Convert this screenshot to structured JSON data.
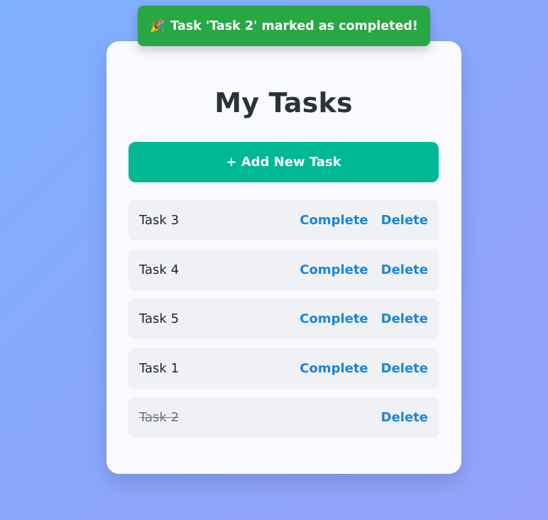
{
  "toast": {
    "icon": "🎉",
    "message": "Task 'Task 2' marked as completed!"
  },
  "page": {
    "title": "My Tasks",
    "add_button_label": "+ Add New Task"
  },
  "tasks": [
    {
      "name": "Task 3",
      "completed": false,
      "complete_label": "Complete",
      "delete_label": "Delete"
    },
    {
      "name": "Task 4",
      "completed": false,
      "complete_label": "Complete",
      "delete_label": "Delete"
    },
    {
      "name": "Task 5",
      "completed": false,
      "complete_label": "Complete",
      "delete_label": "Delete"
    },
    {
      "name": "Task 1",
      "completed": false,
      "complete_label": "Complete",
      "delete_label": "Delete"
    },
    {
      "name": "Task 2",
      "completed": true,
      "delete_label": "Delete"
    }
  ],
  "colors": {
    "toast_bg": "#28a745",
    "add_button_bg": "#00b894",
    "action_link": "#1a86d8",
    "card_bg": "#f8faff",
    "row_bg": "#eff1f5"
  }
}
